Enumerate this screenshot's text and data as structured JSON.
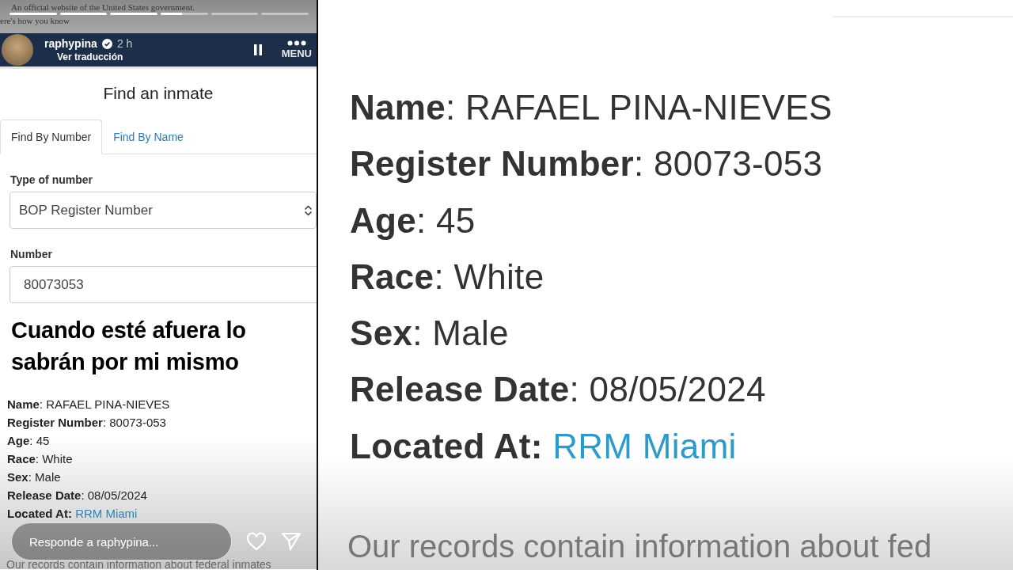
{
  "story": {
    "segments": [
      {
        "level": 1
      },
      {
        "level": 1
      },
      {
        "level": 1
      },
      {
        "level": 0.45
      },
      {
        "level": 0
      },
      {
        "level": 0
      }
    ],
    "banner": {
      "text": "An official website of the United States government.",
      "link": "ere's how you know"
    },
    "user": {
      "name": "raphypina",
      "verified": true,
      "time": "2 h",
      "translate": "Ver traducción",
      "paused": true
    },
    "menu": "MENU",
    "page": {
      "title": "Find an inmate",
      "tabs": [
        {
          "label": "Find By Number",
          "selected": true
        },
        {
          "label": "Find By Name",
          "selected": false
        }
      ],
      "fields": [
        {
          "label": "Type of number",
          "kind": "select",
          "value": "BOP Register Number"
        },
        {
          "label": "Number",
          "kind": "text",
          "value": "80073053"
        }
      ]
    },
    "caption": "Cuando esté afuera lo sabrán por mi mismo",
    "details": [
      {
        "text": "**Name**: RAFAEL PINA-NIEVES"
      },
      {
        "text": "**Register Number**: 80073-053"
      },
      {
        "text": "**Age**: 45"
      },
      {
        "text": "**Race**: White"
      },
      {
        "text": "**Sex**: Male"
      },
      {
        "text": "**Release Date**: 08/05/2024"
      },
      {
        "text": "**Located At:**",
        "link": "RRM Miami"
      }
    ],
    "footer": "Our records contain information about federal inmates",
    "reply": {
      "placeholder": "Responde a raphypina..."
    }
  },
  "zoomed": {
    "details": [
      {
        "text": "**Name**: RAFAEL PINA-NIEVES"
      },
      {
        "text": "**Register Number**: 80073-053"
      },
      {
        "text": "**Age**: 45"
      },
      {
        "text": "**Race**: White"
      },
      {
        "text": "**Sex**: Male"
      },
      {
        "text": "**Release Date**: 08/05/2024"
      },
      {
        "text": "**Located At:**",
        "link": "RRM Miami"
      }
    ],
    "footer": "Our records contain information about fed"
  }
}
